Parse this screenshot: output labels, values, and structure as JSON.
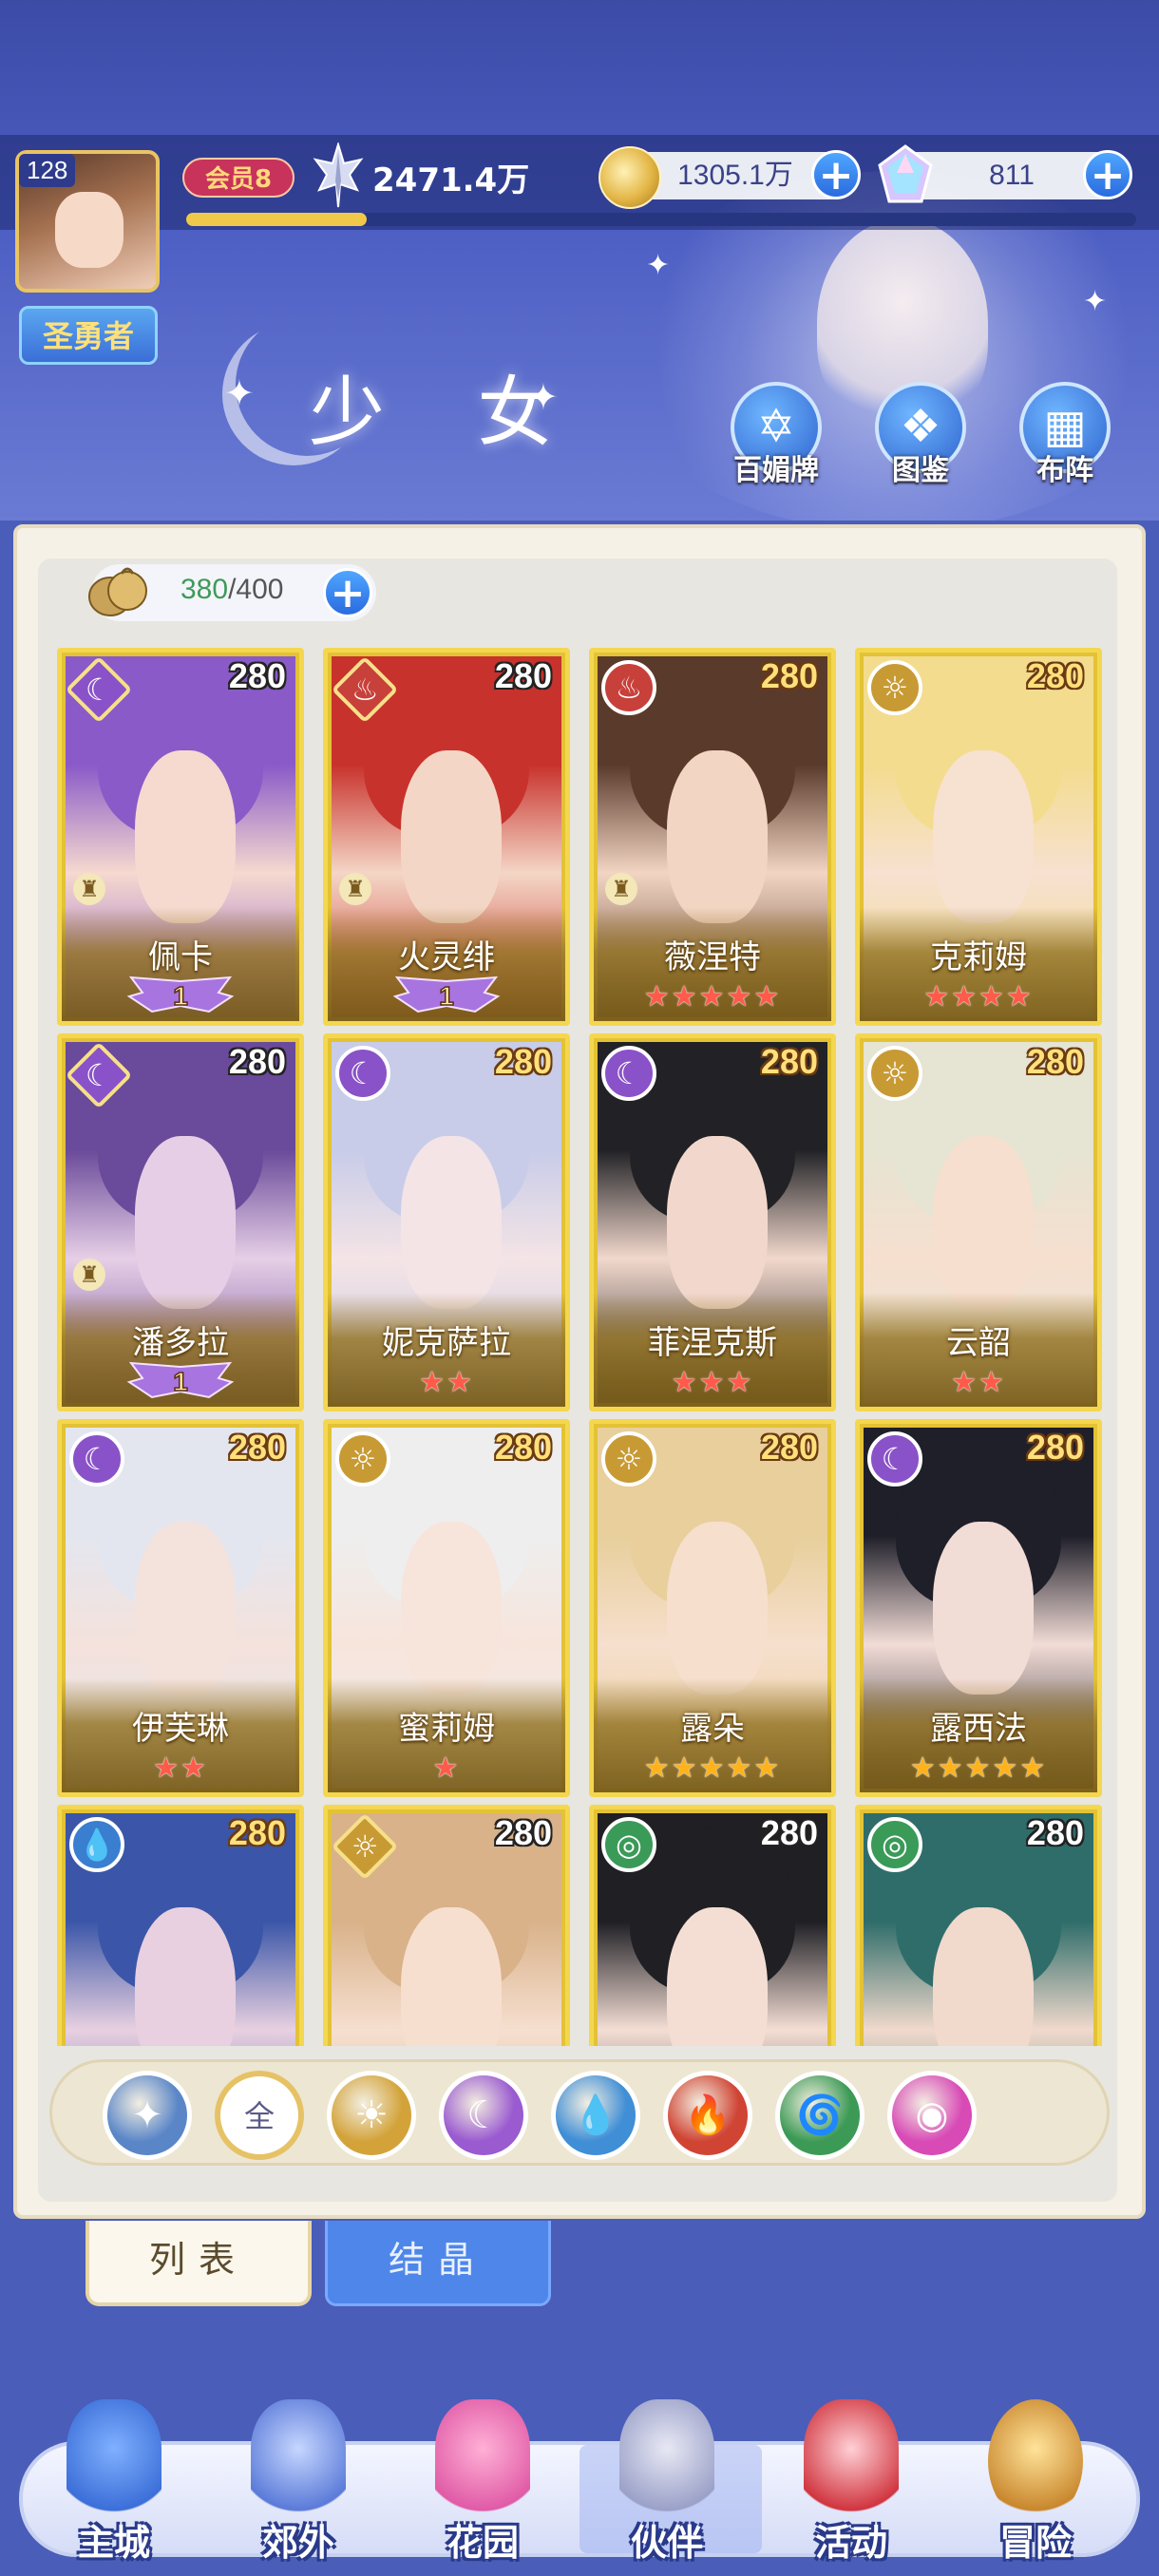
{
  "player": {
    "level": "128",
    "rank": "圣勇者",
    "vip": "会员8",
    "power": "2471.4万",
    "exp_fraction": 0.19
  },
  "resources": {
    "gold": "1305.1万",
    "gems": "811"
  },
  "page_title": "少 女",
  "header_buttons": [
    {
      "label": "百媚牌",
      "icon": "card-icon"
    },
    {
      "label": "图鉴",
      "icon": "book-icon"
    },
    {
      "label": "布阵",
      "icon": "formation-icon"
    }
  ],
  "capacity": {
    "current": "380",
    "max": "/400"
  },
  "cards": [
    {
      "name": "佩卡",
      "level": "280",
      "element": "moon",
      "stars": 0,
      "rank_badge": "1",
      "color": "#8a5ac8",
      "skin": "#f6d9cf"
    },
    {
      "name": "火灵绯",
      "level": "280",
      "element": "fire",
      "stars": 0,
      "rank_badge": "1",
      "color": "#c8322c",
      "skin": "#f4d6c6"
    },
    {
      "name": "薇涅特",
      "level": "280",
      "element": "fire",
      "stars": 5,
      "star_color": "red",
      "color": "#5a3a2a",
      "skin": "#f3d5c4"
    },
    {
      "name": "克莉姆",
      "level": "280",
      "element": "sun",
      "stars": 4,
      "star_color": "red",
      "color": "#f3dc8e",
      "skin": "#f7e1d0"
    },
    {
      "name": "潘多拉",
      "level": "280",
      "element": "moon",
      "stars": 0,
      "rank_badge": "1",
      "color": "#6a4a9a",
      "skin": "#e6cfe6"
    },
    {
      "name": "妮克萨拉",
      "level": "280",
      "element": "moon",
      "stars": 2,
      "star_color": "red",
      "color": "#c8cce8",
      "skin": "#f4e4e6"
    },
    {
      "name": "菲涅克斯",
      "level": "280",
      "element": "moon",
      "stars": 3,
      "star_color": "red",
      "color": "#222226",
      "skin": "#f2d8cc"
    },
    {
      "name": "云韶",
      "level": "280",
      "element": "sun",
      "stars": 2,
      "star_color": "red",
      "color": "#e6e4d2",
      "skin": "#f6dfcf"
    },
    {
      "name": "伊芙琳",
      "level": "280",
      "element": "moon",
      "stars": 2,
      "star_color": "red",
      "color": "#e4e6ef",
      "skin": "#f4e2dc"
    },
    {
      "name": "蜜莉姆",
      "level": "280",
      "element": "sun",
      "stars": 1,
      "star_color": "red",
      "color": "#eeeeee",
      "skin": "#f7e5dc"
    },
    {
      "name": "露朵",
      "level": "280",
      "element": "sun",
      "stars": 5,
      "star_color": "gold",
      "color": "#e8cf9c",
      "skin": "#f6dfcd"
    },
    {
      "name": "露西法",
      "level": "280",
      "element": "moon",
      "stars": 5,
      "star_color": "gold",
      "color": "#1f1f2a",
      "skin": "#f2dcd6"
    },
    {
      "name": "",
      "level": "280",
      "element": "water",
      "stars": 0,
      "color": "#3b56a8",
      "skin": "#e8d0e0"
    },
    {
      "name": "",
      "level": "280",
      "element": "sun",
      "stars": 0,
      "color": "#d9b28a",
      "skin": "#f6dfcf"
    },
    {
      "name": "",
      "level": "280",
      "element": "wind",
      "stars": 0,
      "color": "#1f1f24",
      "skin": "#f4ded4"
    },
    {
      "name": "",
      "level": "280",
      "element": "wind",
      "stars": 0,
      "color": "#2f6d6a",
      "skin": "#f1d9cc"
    }
  ],
  "filters": [
    {
      "key": "light",
      "label": "✦",
      "icon": "light-element-icon",
      "color": "#5a86c8"
    },
    {
      "key": "all",
      "label": "全",
      "icon": "all-filter-icon",
      "color": "#ffffff"
    },
    {
      "key": "sun",
      "label": "☀",
      "icon": "sun-element-icon",
      "color": "#d3a33a"
    },
    {
      "key": "moon",
      "label": "☾",
      "icon": "moon-element-icon",
      "color": "#9a5ad0"
    },
    {
      "key": "water",
      "label": "💧",
      "icon": "water-element-icon",
      "color": "#3f8ed6"
    },
    {
      "key": "fire",
      "label": "🔥",
      "icon": "fire-element-icon",
      "color": "#d04434"
    },
    {
      "key": "wind",
      "label": "🌀",
      "icon": "wind-element-icon",
      "color": "#3c9a56"
    },
    {
      "key": "dark",
      "label": "◉",
      "icon": "dark-element-icon",
      "color": "#d84ab6"
    }
  ],
  "tabs": {
    "list": "列表",
    "crystal": "结晶"
  },
  "nav": [
    {
      "label": "主城",
      "icon": "castle-icon"
    },
    {
      "label": "郊外",
      "icon": "portal-icon"
    },
    {
      "label": "花园",
      "icon": "heart-icon"
    },
    {
      "label": "伙伴",
      "icon": "partner-icon",
      "active": true
    },
    {
      "label": "活动",
      "icon": "gift-icon"
    },
    {
      "label": "冒险",
      "icon": "compass-icon"
    }
  ]
}
